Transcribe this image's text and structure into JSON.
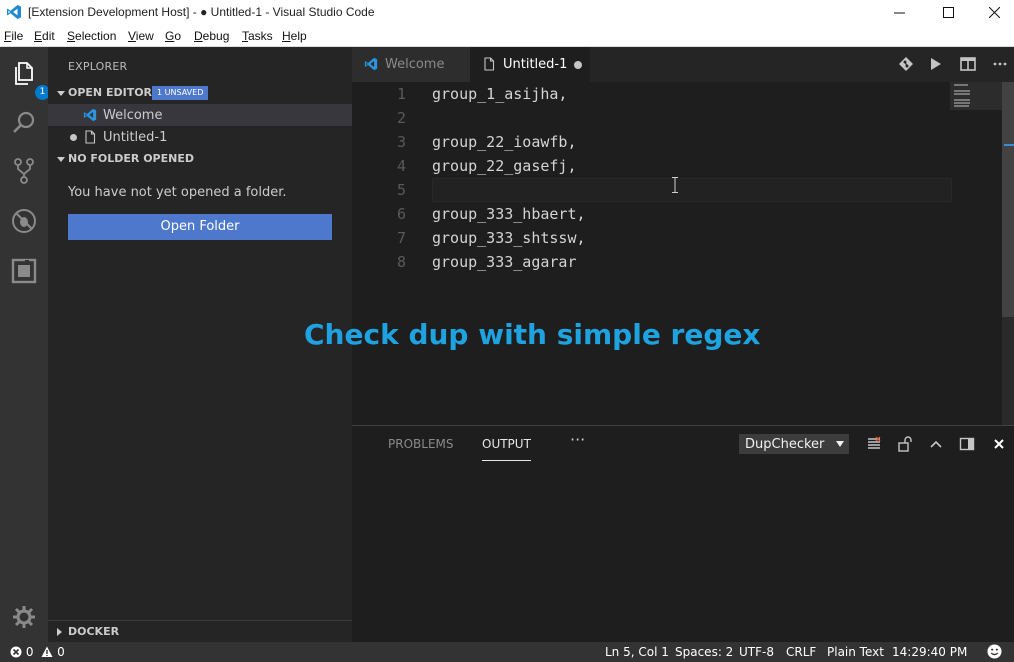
{
  "window": {
    "title": "[Extension Development Host] - ● Untitled-1 - Visual Studio Code"
  },
  "menu": [
    "File",
    "Edit",
    "Selection",
    "View",
    "Go",
    "Debug",
    "Tasks",
    "Help"
  ],
  "menu_mnemonics": [
    "F",
    "E",
    "S",
    "V",
    "G",
    "D",
    "T",
    "H"
  ],
  "activity": {
    "explorer_badge": "1"
  },
  "sidebar": {
    "title": "EXPLORER",
    "open_editors": {
      "label": "OPEN EDITORS",
      "badge": "1 UNSAVED",
      "items": [
        {
          "name": "Welcome"
        },
        {
          "name": "Untitled-1"
        }
      ]
    },
    "no_folder": {
      "label": "NO FOLDER OPENED",
      "message": "You have not yet opened a folder.",
      "button": "Open Folder"
    },
    "docker": {
      "label": "DOCKER"
    }
  },
  "tabs": [
    {
      "label": "Welcome"
    },
    {
      "label": "Untitled-1"
    }
  ],
  "editor": {
    "lines": [
      {
        "n": "1",
        "text": "group_1_asijha,"
      },
      {
        "n": "2",
        "text": ""
      },
      {
        "n": "3",
        "text": "group_22_ioawfb,"
      },
      {
        "n": "4",
        "text": "group_22_gasefj,"
      },
      {
        "n": "5",
        "text": ""
      },
      {
        "n": "6",
        "text": "group_333_hbaert,"
      },
      {
        "n": "7",
        "text": "group_333_shtssw,"
      },
      {
        "n": "8",
        "text": "group_333_agarar"
      }
    ],
    "caption": "Check dup with simple regex"
  },
  "panel": {
    "tabs": [
      "PROBLEMS",
      "OUTPUT"
    ],
    "more": "···",
    "channel": "DupChecker"
  },
  "status": {
    "errors": "0",
    "warnings": "0",
    "position": "Ln 5, Col 1",
    "spaces": "Spaces: 2",
    "encoding": "UTF-8",
    "eol": "CRLF",
    "language": "Plain Text",
    "time": "14:29:40 PM"
  },
  "colors": {
    "accent": "#007acc",
    "button": "#4d78cc",
    "caption": "#1fa2e0"
  }
}
